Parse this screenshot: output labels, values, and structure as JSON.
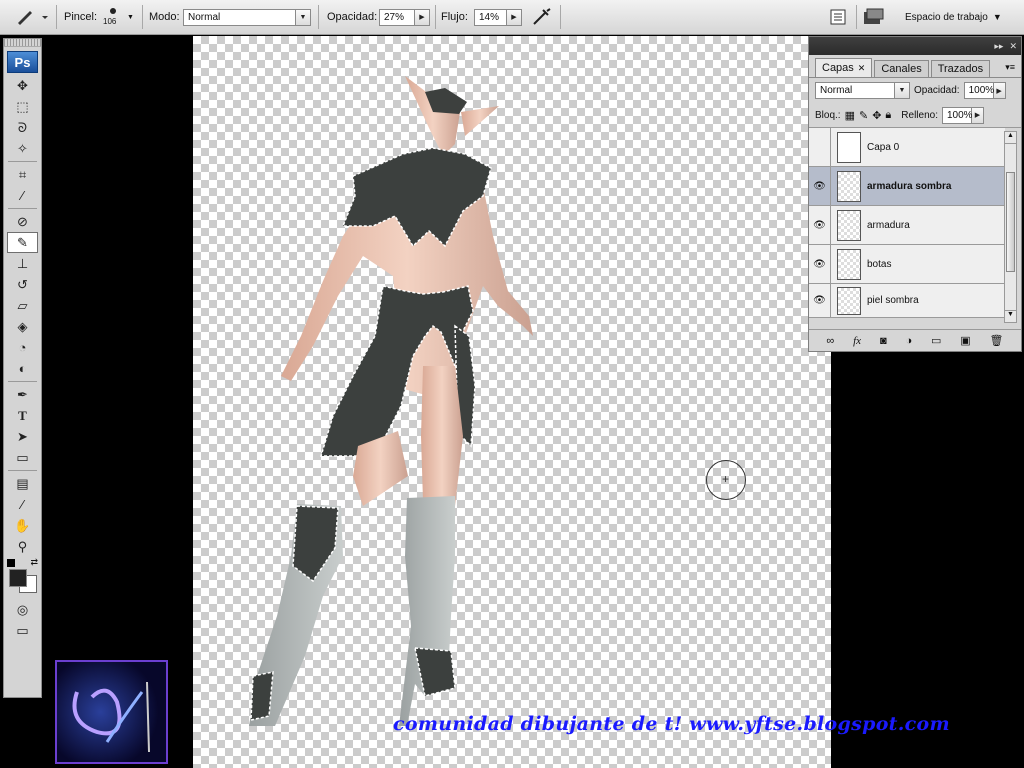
{
  "options_bar": {
    "brush_label": "Pincel:",
    "brush_size": "106",
    "mode_label": "Modo:",
    "mode_value": "Normal",
    "opacity_label": "Opacidad:",
    "opacity_value": "27%",
    "flow_label": "Flujo:",
    "flow_value": "14%",
    "workspace_label": "Espacio de trabajo"
  },
  "toolbox": {
    "logo": "Ps"
  },
  "layers_panel": {
    "tabs": [
      {
        "label": "Capas"
      },
      {
        "label": "Canales"
      },
      {
        "label": "Trazados"
      }
    ],
    "blend_mode": "Normal",
    "opacity_label": "Opacidad:",
    "opacity_value": "100%",
    "lock_label": "Bloq.:",
    "fill_label": "Relleno:",
    "fill_value": "100%",
    "layers": [
      {
        "name": "Capa 0",
        "visible": false,
        "selected": false
      },
      {
        "name": "armadura sombra",
        "visible": true,
        "selected": true
      },
      {
        "name": "armadura",
        "visible": true,
        "selected": false
      },
      {
        "name": "botas",
        "visible": true,
        "selected": false
      },
      {
        "name": "piel sombra",
        "visible": true,
        "selected": false
      }
    ]
  },
  "watermark": "comunidad dibujante de t! www.yftse.blogspot.com"
}
